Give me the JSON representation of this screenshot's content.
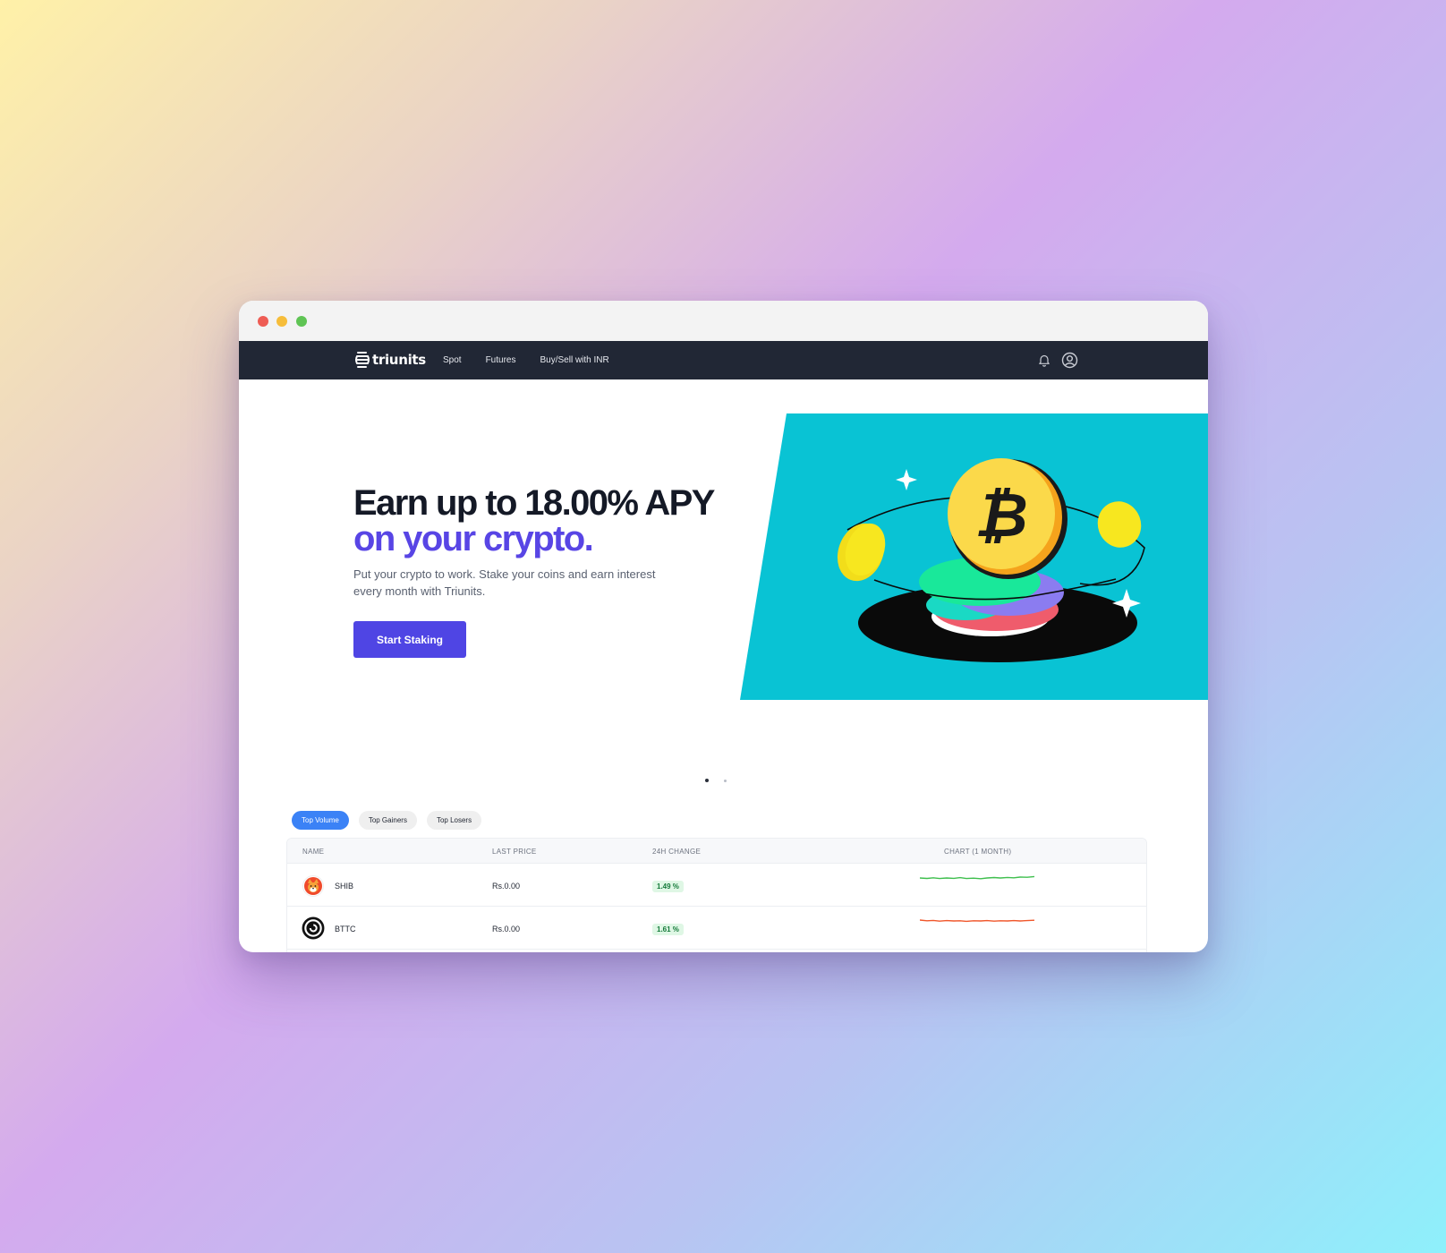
{
  "browser": {
    "controls": [
      "close",
      "minimize",
      "maximize"
    ]
  },
  "navbar": {
    "brand": "triunits",
    "links": [
      "Spot",
      "Futures",
      "Buy/Sell with INR"
    ],
    "icons": [
      "bell-icon",
      "user-circle-icon"
    ]
  },
  "hero": {
    "title_line1": "Earn up to 18.00% APY",
    "title_line2": "on your crypto.",
    "subtitle": "Put your crypto to work. Stake your coins and earn interest every month with Triunits.",
    "cta_label": "Start Staking",
    "banner_color": "#09c3d4",
    "accent_color": "#5845e5"
  },
  "carousel": {
    "slides": 2,
    "active_index": 0
  },
  "market": {
    "tabs": [
      {
        "label": "Top Volume",
        "active": true
      },
      {
        "label": "Top Gainers",
        "active": false
      },
      {
        "label": "Top Losers",
        "active": false
      }
    ],
    "columns": [
      "NAME",
      "LAST PRICE",
      "24H CHANGE",
      "CHART (1 MONTH)"
    ],
    "rows": [
      {
        "name": "SHIB",
        "price": "Rs.0.00",
        "change": "1.49 %",
        "chart_color": "#3fbf4e"
      },
      {
        "name": "BTTC",
        "price": "Rs.0.00",
        "change": "1.61 %",
        "chart_color": "#f0562a"
      }
    ]
  }
}
